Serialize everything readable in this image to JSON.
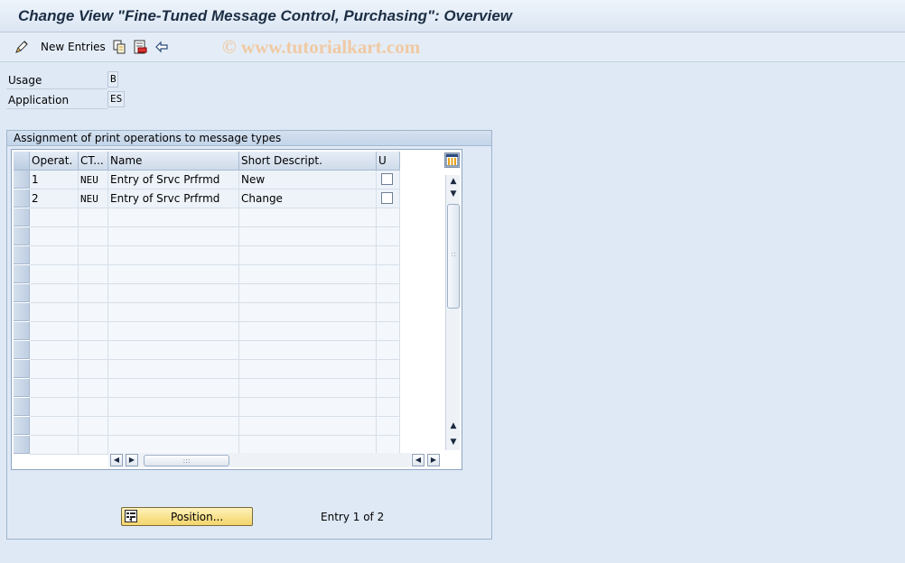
{
  "window": {
    "title": "Change View \"Fine-Tuned Message Control, Purchasing\": Overview"
  },
  "toolbar": {
    "new_entries_label": "New Entries",
    "watermark": "© www.tutorialkart.com",
    "icons": [
      "edit-pencil-icon",
      "copy-icon",
      "delete-icon",
      "undo-icon"
    ]
  },
  "fields": {
    "usage": {
      "label": "Usage",
      "value": "B"
    },
    "application": {
      "label": "Application",
      "value": "ES"
    }
  },
  "group": {
    "title": "Assignment of print operations to message types"
  },
  "table": {
    "columns": [
      "Operat.",
      "CT...",
      "Name",
      "Short Descript.",
      "U"
    ],
    "rows": [
      {
        "operation": "1",
        "ct": "NEU",
        "name": "Entry of Srvc Prfrmd",
        "short_descript": "New",
        "u": false
      },
      {
        "operation": "2",
        "ct": "NEU",
        "name": "Entry of Srvc Prfrmd",
        "short_descript": "Change",
        "u": false
      }
    ],
    "empty_rows": 13
  },
  "footer": {
    "position_button_label": "Position...",
    "entry_info": "Entry 1 of 2"
  }
}
